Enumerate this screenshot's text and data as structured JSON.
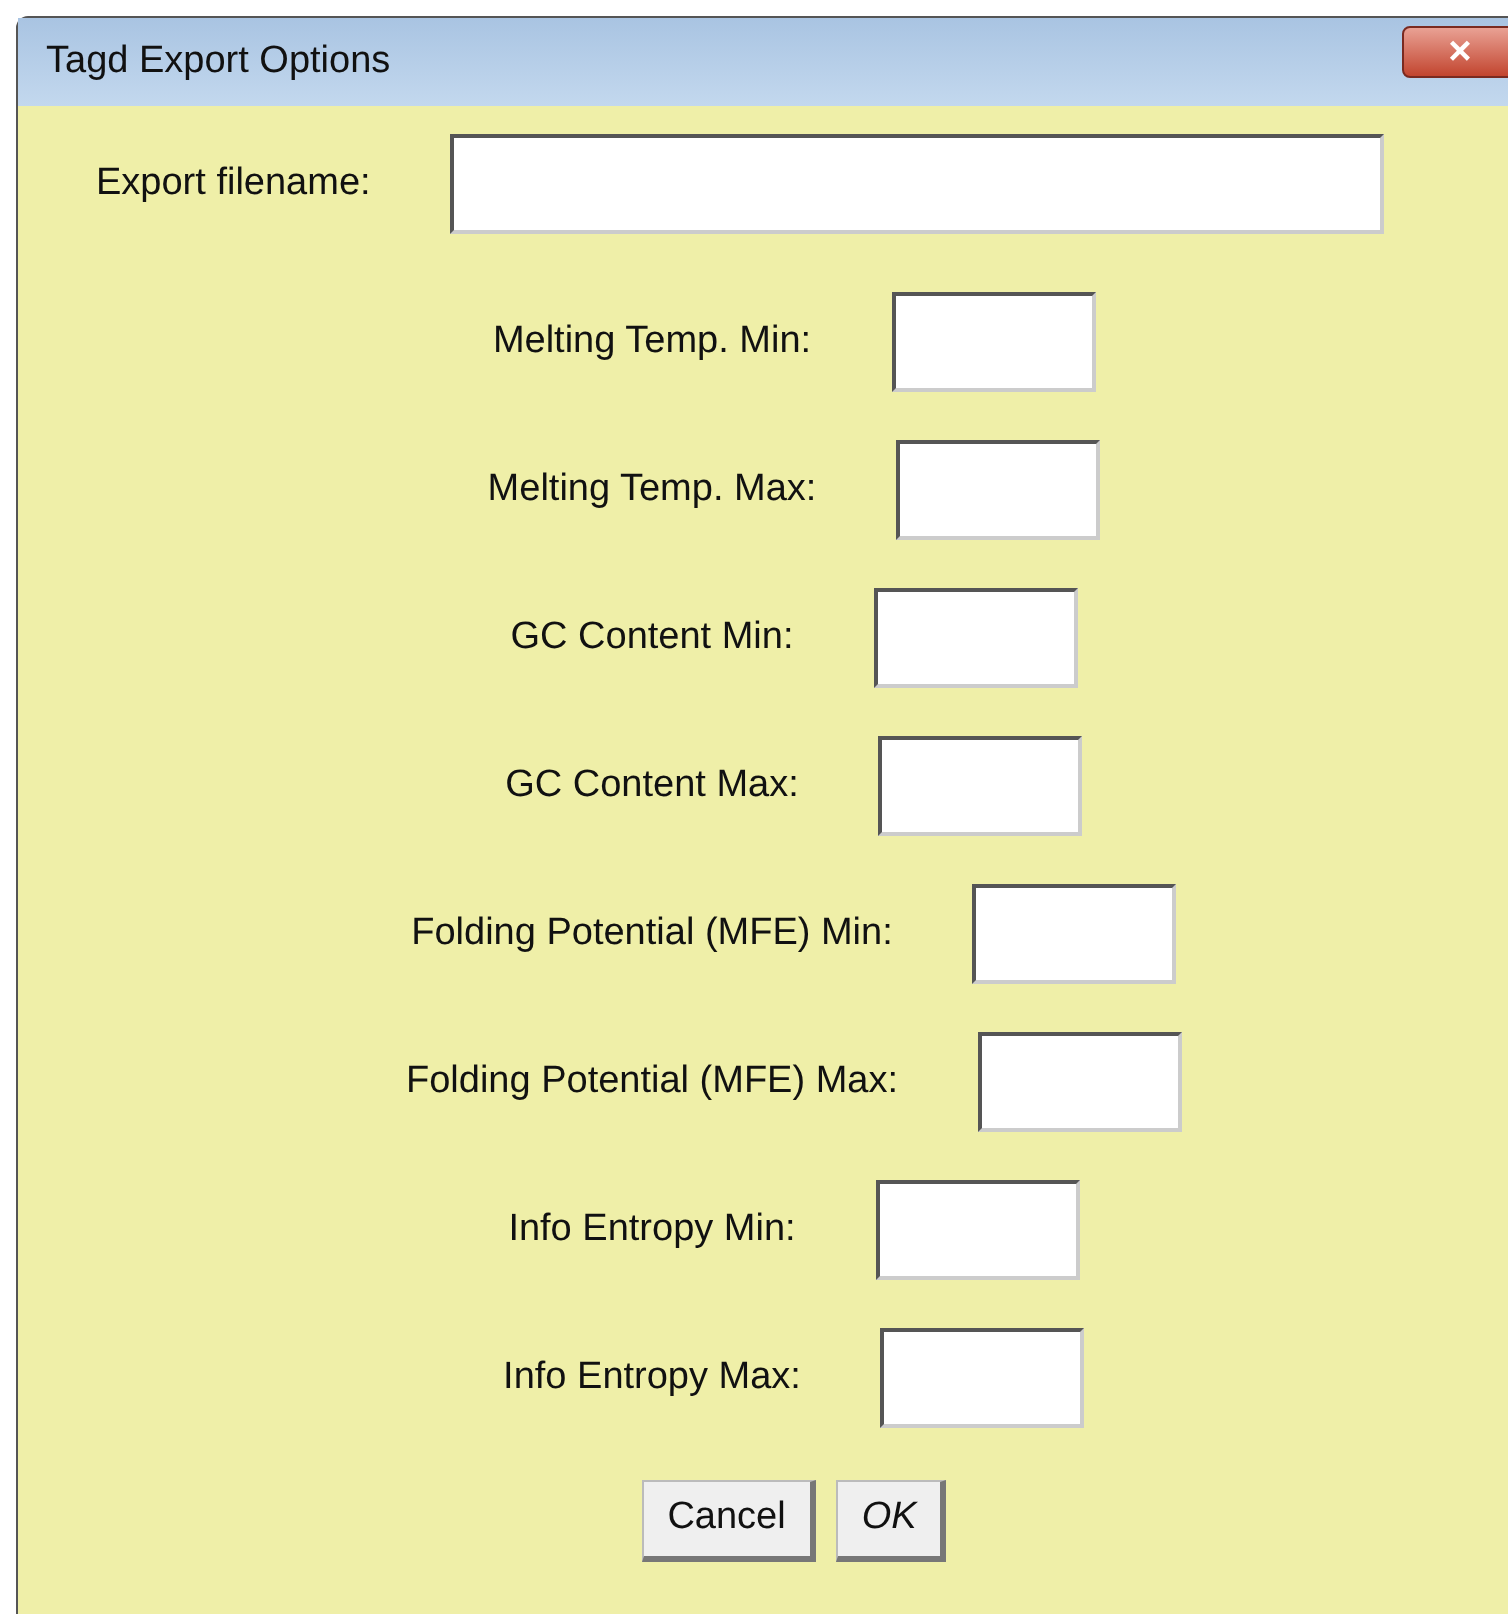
{
  "window": {
    "title": "Tagd Export Options",
    "close": "×"
  },
  "filename": {
    "label": "Export filename:"
  },
  "fields": [
    {
      "label": "Melting Temp. Min:"
    },
    {
      "label": "Melting Temp. Max:"
    },
    {
      "label": "GC Content Min:"
    },
    {
      "label": "GC Content Max:"
    },
    {
      "label": "Folding Potential (MFE) Min:"
    },
    {
      "label": "Folding Potential (MFE) Max:"
    },
    {
      "label": "Info Entropy Min:"
    },
    {
      "label": "Info Entropy Max:"
    }
  ],
  "buttons": [
    {
      "label": "Cancel",
      "italic": false
    },
    {
      "label": "OK",
      "italic": true
    }
  ]
}
